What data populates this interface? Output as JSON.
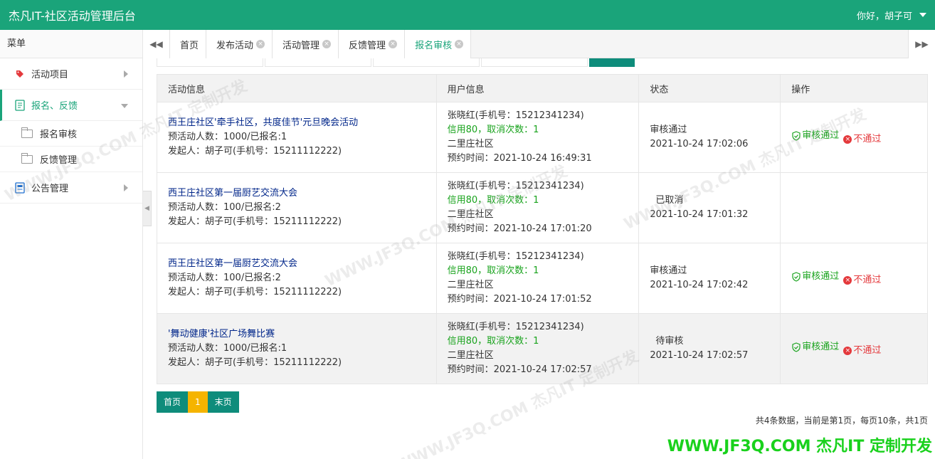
{
  "header": {
    "title": "杰凡IT-社区活动管理后台",
    "user": "你好，胡子可"
  },
  "sidebar": {
    "title": "菜单",
    "items": [
      {
        "label": "活动项目"
      },
      {
        "label": "报名、反馈"
      },
      {
        "label": "公告管理"
      }
    ],
    "sub_items": [
      {
        "label": "报名审核"
      },
      {
        "label": "反馈管理"
      }
    ]
  },
  "tabs": {
    "items": [
      {
        "label": "首页"
      },
      {
        "label": "发布活动"
      },
      {
        "label": "活动管理"
      },
      {
        "label": "反馈管理"
      },
      {
        "label": "报名审核"
      }
    ],
    "prev_glyph": "◀◀",
    "next_glyph": "▶▶"
  },
  "table": {
    "headers": [
      "活动信息",
      "用户信息",
      "状态",
      "操作"
    ],
    "rows": [
      {
        "act_title": "西王庄社区'牵手社区，共度佳节'元旦晚会活动",
        "act_count": "预活动人数：1000/已报名:1",
        "act_owner": "发起人：胡子可(手机号：15211112222)",
        "user_name": "张晓红(手机号：15212341234)",
        "user_credit": "信用80，取消次数：1",
        "user_area": "二里庄社区",
        "user_time": "预约时间：2021-10-24 16:49:31",
        "status": "审核通过",
        "status_time": "2021-10-24 17:02:06",
        "ok_label": "审核通过",
        "no_label": "不通过"
      },
      {
        "act_title": "西王庄社区第一届厨艺交流大会",
        "act_count": "预活动人数：100/已报名:2",
        "act_owner": "发起人：胡子可(手机号：15211112222)",
        "user_name": "张晓红(手机号：15212341234)",
        "user_credit": "信用80，取消次数：1",
        "user_area": "二里庄社区",
        "user_time": "预约时间：2021-10-24 17:01:20",
        "status": "已取消",
        "status_time": "2021-10-24 17:01:32",
        "ok_label": "",
        "no_label": ""
      },
      {
        "act_title": "西王庄社区第一届厨艺交流大会",
        "act_count": "预活动人数：100/已报名:2",
        "act_owner": "发起人：胡子可(手机号：15211112222)",
        "user_name": "张晓红(手机号：15212341234)",
        "user_credit": "信用80，取消次数：1",
        "user_area": "二里庄社区",
        "user_time": "预约时间：2021-10-24 17:01:52",
        "status": "审核通过",
        "status_time": "2021-10-24 17:02:42",
        "ok_label": "审核通过",
        "no_label": "不通过"
      },
      {
        "act_title": "'舞动健康'社区广场舞比赛",
        "act_count": "预活动人数：1000/已报名:1",
        "act_owner": "发起人：胡子可(手机号：15211112222)",
        "user_name": "张晓红(手机号：15212341234)",
        "user_credit": "信用80，取消次数：1",
        "user_area": "二里庄社区",
        "user_time": "预约时间：2021-10-24 17:02:57",
        "status": "待审核",
        "status_time": "2021-10-24 17:02:57",
        "ok_label": "审核通过",
        "no_label": "不通过"
      }
    ]
  },
  "pager": {
    "first": "首页",
    "current": "1",
    "last": "末页"
  },
  "summary": "共4条数据，当前是第1页，每页10条，共1页",
  "watermark": "WWW.JF3Q.COM 杰凡IT  定制开发",
  "colors": {
    "primary": "#1aa47a",
    "accent": "#0e8c7b",
    "pager_current": "#f5b400",
    "ok": "#19a31d",
    "no": "#e4393c",
    "link": "#01268a"
  }
}
